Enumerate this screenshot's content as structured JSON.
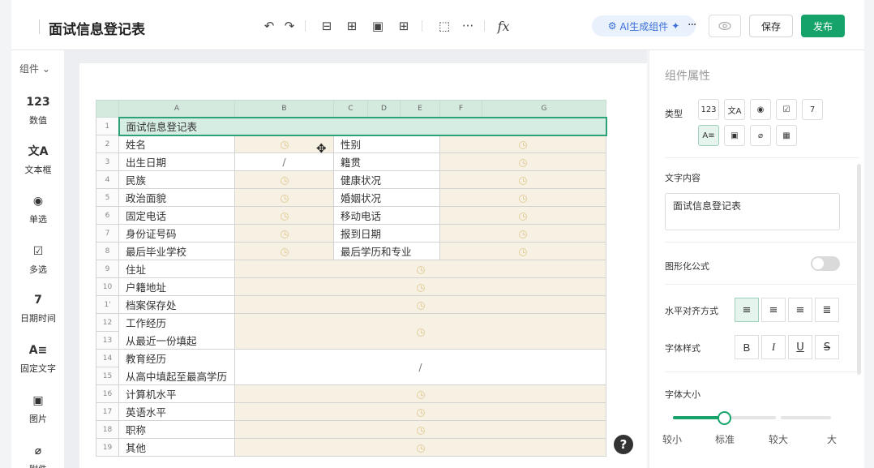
{
  "page_title": "面试信息登记表",
  "toolbar": {
    "ai_label": "AI生成组件",
    "save_label": "保存",
    "publish_label": "发布",
    "fx_label": "fx"
  },
  "sidebar": {
    "header": "组件",
    "items": [
      {
        "icon": "123",
        "label": "数值"
      },
      {
        "icon": "文A",
        "label": "文本框"
      },
      {
        "icon": "◉",
        "label": "单选"
      },
      {
        "icon": "☑",
        "label": "多选"
      },
      {
        "icon": "7",
        "label": "日期时间"
      },
      {
        "icon": "A≡",
        "label": "固定文字"
      },
      {
        "icon": "▣",
        "label": "图片"
      },
      {
        "icon": "⌀",
        "label": "附件"
      }
    ]
  },
  "sheet": {
    "col_headers": [
      "A",
      "B",
      "C",
      "D",
      "E",
      "F",
      "G"
    ],
    "title_row": {
      "num": "1",
      "text": "面试信息登记表"
    },
    "pair_rows": [
      {
        "num": "2",
        "left": "姓名",
        "right": "性别",
        "b": "clock",
        "g": "clock"
      },
      {
        "num": "3",
        "left": "出生日期",
        "right": "籍贯",
        "b": "/",
        "g": "clock"
      },
      {
        "num": "4",
        "left": "民族",
        "right": "健康状况",
        "b": "clock",
        "g": "clock"
      },
      {
        "num": "5",
        "left": "政治面貌",
        "right": "婚姻状况",
        "b": "clock",
        "g": "clock"
      },
      {
        "num": "6",
        "left": "固定电话",
        "right": "移动电话",
        "b": "clock",
        "g": "clock"
      },
      {
        "num": "7",
        "left": "身份证号码",
        "right": "报到日期",
        "b": "clock",
        "g": "clock"
      },
      {
        "num": "8",
        "left": "最后毕业学校",
        "right": "最后学历和专业",
        "b": "clock",
        "g": "clock"
      }
    ],
    "wide_rows": [
      {
        "num": "9",
        "label": "住址"
      },
      {
        "num": "10",
        "label": "户籍地址"
      },
      {
        "num": "1'",
        "label": "档案保存处"
      }
    ],
    "work": {
      "nums": [
        "12",
        "13"
      ],
      "labels": [
        "工作经历",
        "从最近一份填起"
      ]
    },
    "edu": {
      "nums": [
        "14",
        "15"
      ],
      "labels": [
        "教育经历",
        "从高中填起至最高学历"
      ],
      "value": "/"
    },
    "tail_rows": [
      {
        "num": "16",
        "label": "计算机水平"
      },
      {
        "num": "17",
        "label": "英语水平"
      },
      {
        "num": "18",
        "label": "职称"
      },
      {
        "num": "19",
        "label": "其他"
      }
    ]
  },
  "panel": {
    "title": "组件属性",
    "type_label": "类型",
    "type_icons": [
      "123",
      "文A",
      "◉",
      "☑",
      "7",
      "A≡",
      "▣",
      "⌀",
      "▦"
    ],
    "content_label": "文字内容",
    "content_value": "面试信息登记表",
    "formula_label": "图形化公式",
    "align_label": "水平对齐方式",
    "font_style_label": "字体样式",
    "font_size_label": "字体大小",
    "font_size_options": [
      "较小",
      "标准",
      "较大",
      "大"
    ],
    "font_size_selected": "标准"
  },
  "colors": {
    "accent": "#16a36a",
    "header_green": "#d4eadf",
    "cell_tan": "#f7f1e4"
  }
}
